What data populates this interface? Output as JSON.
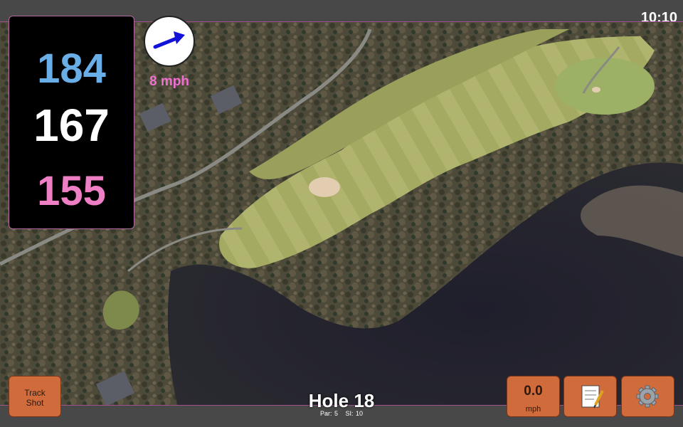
{
  "status": {
    "time": "10:10"
  },
  "distances": {
    "back": "184",
    "middle": "167",
    "front": "155"
  },
  "wind": {
    "speed": "8 mph",
    "icon": "arrow-icon"
  },
  "hole": {
    "title": "Hole 18",
    "par_label": "Par: 5",
    "si_label": "SI: 10"
  },
  "buttons": {
    "track_shot_line1": "Track",
    "track_shot_line2": "Shot",
    "speed_value": "0.0",
    "speed_unit": "mph",
    "notes_icon": "notepad-icon",
    "settings_icon": "gear-icon"
  },
  "colors": {
    "back": "#6aaee8",
    "middle": "#ffffff",
    "front": "#ee7fc4",
    "wind": "#f070d2",
    "button": "#d06b3c"
  }
}
